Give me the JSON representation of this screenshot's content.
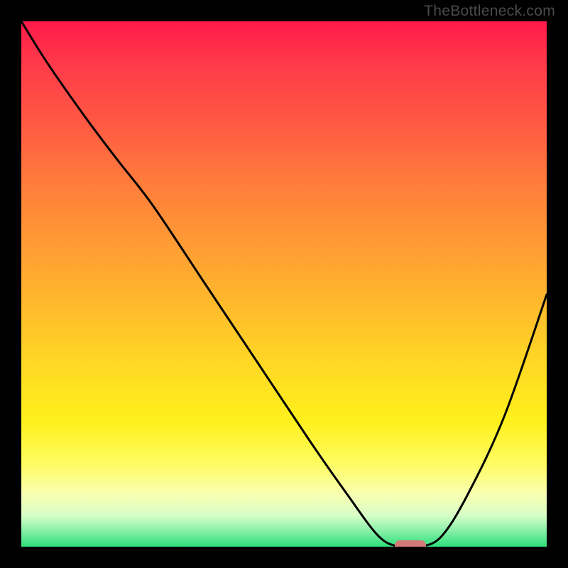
{
  "watermark": "TheBottleneck.com",
  "chart_data": {
    "type": "line",
    "title": "",
    "xlabel": "",
    "ylabel": "",
    "x_range": [
      0,
      100
    ],
    "y_range": [
      0,
      100
    ],
    "series": [
      {
        "name": "bottleneck-curve",
        "x": [
          0,
          5,
          12,
          18,
          25,
          35,
          45,
          55,
          62,
          68,
          72,
          76,
          80,
          85,
          92,
          100
        ],
        "y": [
          100,
          92,
          82,
          74,
          65,
          50,
          35,
          20,
          10,
          2,
          0,
          0,
          2,
          10,
          25,
          48
        ]
      }
    ],
    "optimal_marker": {
      "x": 74,
      "y": 0
    },
    "background_gradient": {
      "top": "#ff1a4a",
      "middle": "#ffda24",
      "bottom": "#2de07a"
    }
  }
}
